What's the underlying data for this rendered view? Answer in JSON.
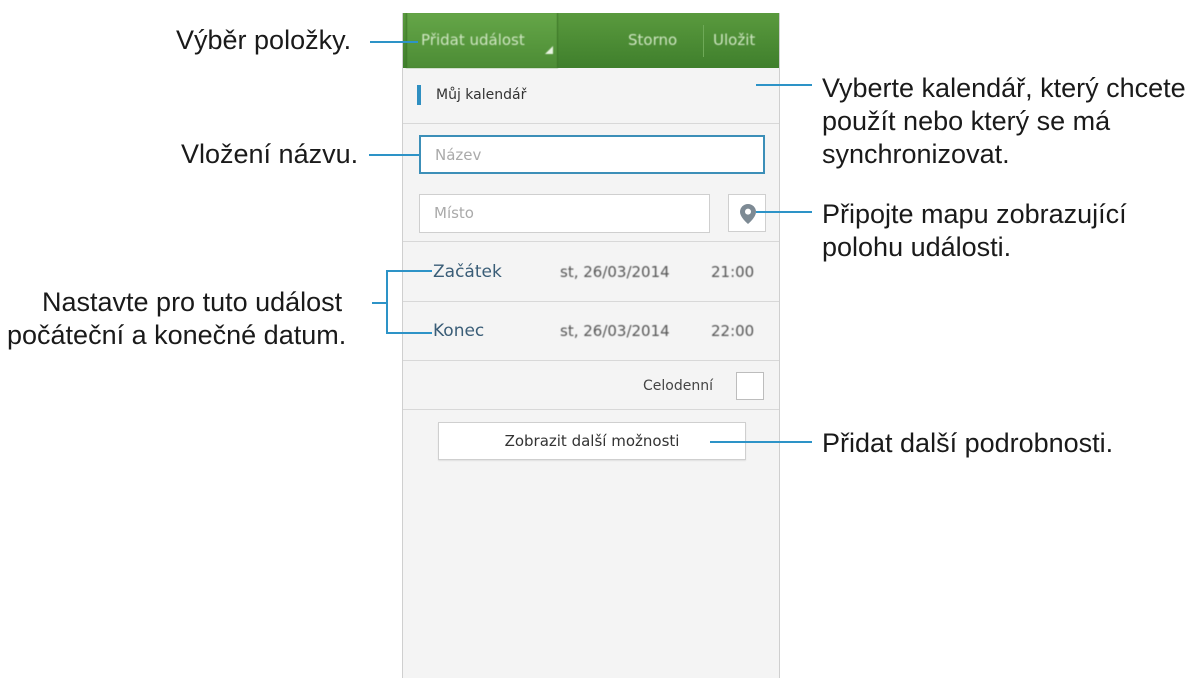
{
  "screen": {
    "action_bar": {
      "select_label": "Přidat událost",
      "cancel_label": "Storno",
      "save_label": "Uložit"
    },
    "calendar": {
      "label": "Můj kalendář",
      "color": "#2f8fc1"
    },
    "title_field": {
      "placeholder": "Název"
    },
    "location_field": {
      "placeholder": "Místo"
    },
    "map_button": {
      "icon": "map-pin-icon"
    },
    "start": {
      "label": "Začátek",
      "date": "st, 26/03/2014",
      "time": "21:00"
    },
    "end": {
      "label": "Konec",
      "date": "st, 26/03/2014",
      "time": "22:00"
    },
    "all_day": {
      "label": "Celodenní",
      "checked": false
    },
    "more_options_label": "Zobrazit další možnosti"
  },
  "callouts": {
    "select_item": "Výběr položky.",
    "insert_title": "Vložení názvu.",
    "set_dates": [
      "Nastavte pro tuto událost",
      "počáteční a konečné datum."
    ],
    "choose_calendar": [
      "Vyberte kalendář, který chcete",
      "použít nebo který se má",
      "synchronizovat."
    ],
    "attach_map": [
      "Připojte mapu zobrazující",
      "polohu události."
    ],
    "add_details": "Přidat další podrobnosti."
  },
  "colors": {
    "action_bar": "#4a8a33",
    "accent_blue": "#2d93c7",
    "focused_border": "#3c8fb8"
  }
}
